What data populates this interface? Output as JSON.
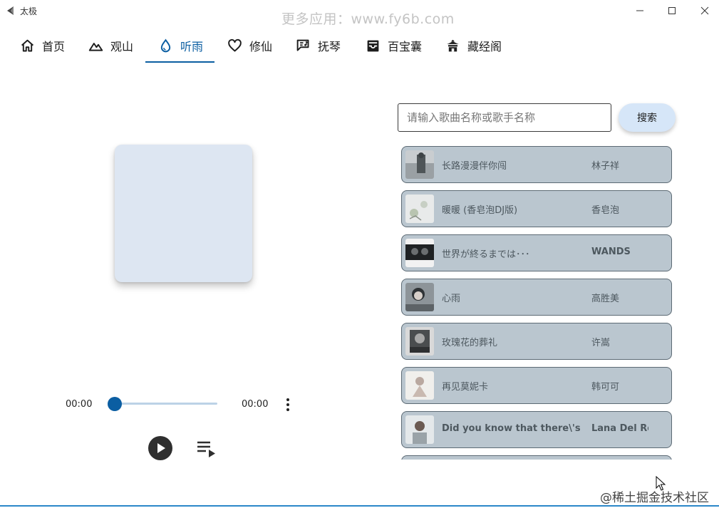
{
  "window": {
    "title": "太极",
    "watermark": "更多应用：www.fy6b.com",
    "minimize_icon": "minimize-icon",
    "maximize_icon": "maximize-icon",
    "close_icon": "close-icon"
  },
  "nav": {
    "active_tab": "听雨",
    "accent_color": "#0b5ea2",
    "tabs": [
      {
        "label": "首页",
        "icon": "home-icon"
      },
      {
        "label": "观山",
        "icon": "mountain-icon"
      },
      {
        "label": "听雨",
        "icon": "water-drop-icon"
      },
      {
        "label": "修仙",
        "icon": "heart-icon"
      },
      {
        "label": "抚琴",
        "icon": "music-note-icon"
      },
      {
        "label": "百宝囊",
        "icon": "inbox-icon"
      },
      {
        "label": "藏经阁",
        "icon": "temple-icon"
      }
    ]
  },
  "player": {
    "current_time": "00:00",
    "total_time": "00:00",
    "progress": 0,
    "more_icon": "more-vert-icon",
    "play_icon": "play-icon",
    "playlist_icon": "playlist-icon"
  },
  "search": {
    "placeholder": "请输入歌曲名称或歌手名称",
    "value": "",
    "button_label": "搜索"
  },
  "songs": [
    {
      "title": "长路漫漫伴你闯",
      "artist": "林子祥"
    },
    {
      "title": "暖暖 (香皂泡DJ版)",
      "artist": "香皂泡"
    },
    {
      "title": "世界が終るまでは･･･",
      "artist": "WANDS"
    },
    {
      "title": "心雨",
      "artist": "高胜美"
    },
    {
      "title": "玫瑰花的葬礼",
      "artist": "许嵩"
    },
    {
      "title": "再见莫妮卡",
      "artist": "韩可可"
    },
    {
      "title": "Did you know that there\\'s a",
      "artist": "Lana Del Re"
    }
  ],
  "footer": {
    "watermark": "@稀土掘金技术社区"
  }
}
